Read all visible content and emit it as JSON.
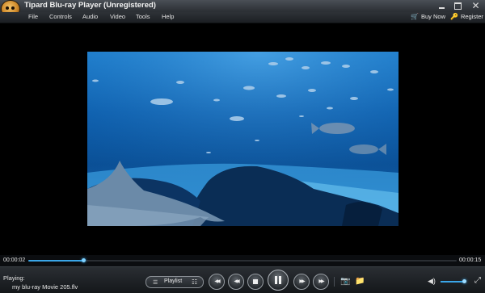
{
  "window": {
    "title": "Tipard Blu-ray Player (Unregistered)",
    "minimize_icon": "minimize-icon",
    "maximize_icon": "maximize-icon",
    "close_glyph": "✕"
  },
  "menu": {
    "items": [
      "File",
      "Controls",
      "Audio",
      "Video",
      "Tools",
      "Help"
    ],
    "buy_now": "Buy Now",
    "register": "Register"
  },
  "player": {
    "time_current": "00:00:02",
    "time_total": "00:00:15",
    "progress_fraction": 0.13,
    "playing_label": "Playing:",
    "file_name": "my blu-ray Movie 205.flv",
    "playlist_label": "Playlist",
    "volume_fraction": 0.95
  },
  "icons": {
    "playlist_menu": "☰",
    "playlist_list": "☷",
    "prev": "◀◀",
    "rewind": "◀◀",
    "forward": "▶▶",
    "next": "▶▶",
    "snapshot": "📷",
    "folder": "📁",
    "volume": "◀)",
    "fullscreen": "⤢"
  },
  "colors": {
    "accent": "#3aa6e8",
    "background": "#000000",
    "chrome": "#2a2e33"
  }
}
